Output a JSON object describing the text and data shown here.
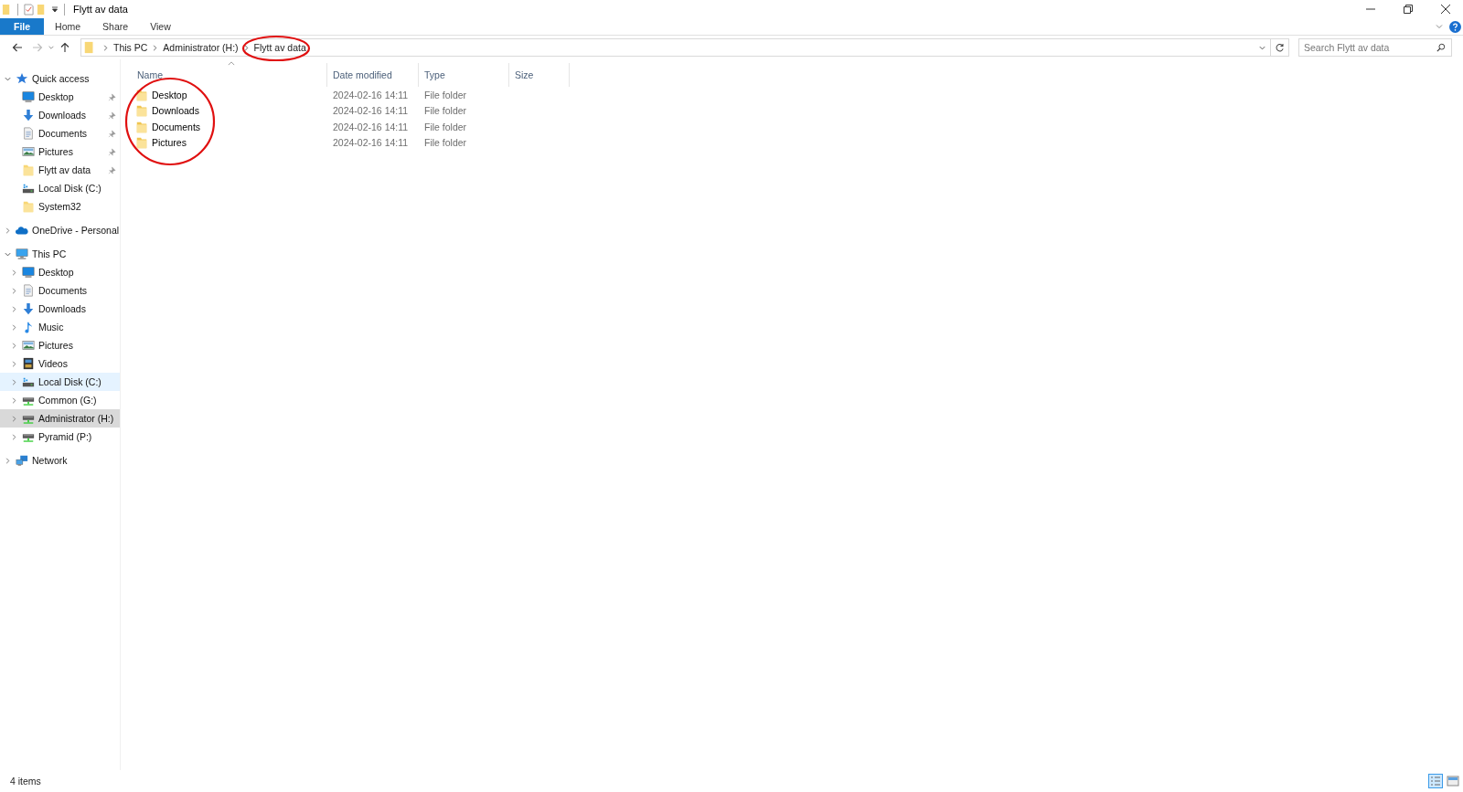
{
  "window": {
    "title": "Flytt av data"
  },
  "ribbon_tabs": [
    {
      "label": "File",
      "kind": "file",
      "selected": false
    },
    {
      "label": "Home",
      "kind": "tab",
      "selected": false
    },
    {
      "label": "Share",
      "kind": "tab",
      "selected": false
    },
    {
      "label": "View",
      "kind": "tab",
      "selected": false
    }
  ],
  "address_bar": {
    "crumbs": [
      "This PC",
      "Administrator (H:)",
      "Flytt av data"
    ]
  },
  "search": {
    "placeholder": "Search Flytt av data"
  },
  "sidebar": {
    "items": [
      {
        "label": "Quick access",
        "kind": "star",
        "expanded": true,
        "selected": false,
        "hovered": false,
        "children": [
          {
            "label": "Desktop",
            "kind": "desktop",
            "pinned": true,
            "selected": false,
            "hovered": false
          },
          {
            "label": "Downloads",
            "kind": "download",
            "pinned": true,
            "selected": false,
            "hovered": false
          },
          {
            "label": "Documents",
            "kind": "document",
            "pinned": true,
            "selected": false,
            "hovered": false
          },
          {
            "label": "Pictures",
            "kind": "picture",
            "pinned": true,
            "selected": false,
            "hovered": false
          },
          {
            "label": "Flytt av data",
            "kind": "folder",
            "pinned": true,
            "selected": false,
            "hovered": false
          },
          {
            "label": "Local Disk (C:)",
            "kind": "disk",
            "pinned": false,
            "selected": false,
            "hovered": false
          },
          {
            "label": "System32",
            "kind": "folder",
            "pinned": false,
            "selected": false,
            "hovered": false
          }
        ]
      },
      {
        "label": "OneDrive - Personal",
        "kind": "cloud",
        "expanded": false,
        "selected": false,
        "hovered": false
      },
      {
        "label": "This PC",
        "kind": "pc",
        "expanded": true,
        "selected": false,
        "hovered": false,
        "children": [
          {
            "label": "Desktop",
            "kind": "desktop",
            "expanded": false,
            "selected": false,
            "hovered": false
          },
          {
            "label": "Documents",
            "kind": "document",
            "expanded": false,
            "selected": false,
            "hovered": false
          },
          {
            "label": "Downloads",
            "kind": "download",
            "expanded": false,
            "selected": false,
            "hovered": false
          },
          {
            "label": "Music",
            "kind": "music",
            "expanded": false,
            "selected": false,
            "hovered": false
          },
          {
            "label": "Pictures",
            "kind": "picture",
            "expanded": false,
            "selected": false,
            "hovered": false
          },
          {
            "label": "Videos",
            "kind": "video",
            "expanded": false,
            "selected": false,
            "hovered": false
          },
          {
            "label": "Local Disk (C:)",
            "kind": "disk",
            "expanded": false,
            "selected": false,
            "hovered": true
          },
          {
            "label": "Common (G:)",
            "kind": "netdrive",
            "expanded": false,
            "selected": false,
            "hovered": false
          },
          {
            "label": "Administrator (H:)",
            "kind": "netdrive",
            "expanded": false,
            "selected": true,
            "hovered": false
          },
          {
            "label": "Pyramid (P:)",
            "kind": "netdrive",
            "expanded": false,
            "selected": false,
            "hovered": false
          }
        ]
      },
      {
        "label": "Network",
        "kind": "network",
        "expanded": false,
        "selected": false,
        "hovered": false
      }
    ]
  },
  "file_list": {
    "columns": [
      "Name",
      "Date modified",
      "Type",
      "Size"
    ],
    "rows": [
      {
        "name": "Desktop",
        "date_modified": "2024-02-16 14:11",
        "type": "File folder"
      },
      {
        "name": "Downloads",
        "date_modified": "2024-02-16 14:11",
        "type": "File folder"
      },
      {
        "name": "Documents",
        "date_modified": "2024-02-16 14:11",
        "type": "File folder"
      },
      {
        "name": "Pictures",
        "date_modified": "2024-02-16 14:11",
        "type": "File folder"
      }
    ]
  },
  "status_bar": {
    "item_count": "4 items"
  }
}
